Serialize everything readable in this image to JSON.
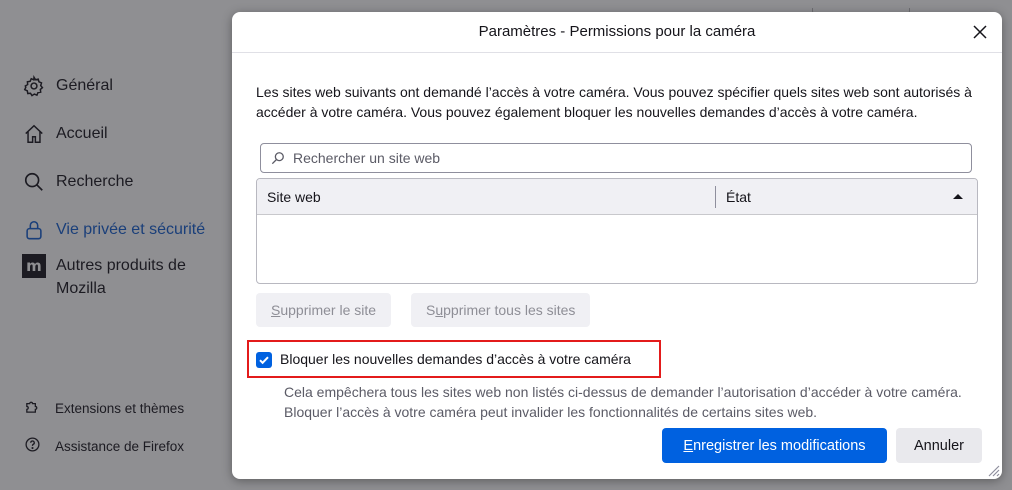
{
  "sidebar": {
    "items": [
      {
        "label": "Général",
        "icon": "gear-icon"
      },
      {
        "label": "Accueil",
        "icon": "home-icon"
      },
      {
        "label": "Recherche",
        "icon": "search-icon"
      },
      {
        "label": "Vie privée et sécurité",
        "icon": "lock-icon"
      },
      {
        "label": "Autres produits de Mozilla",
        "icon": "mozilla-icon"
      }
    ],
    "footer": [
      {
        "label": "Extensions et thèmes",
        "icon": "puzzle-icon"
      },
      {
        "label": "Assistance de Firefox",
        "icon": "help-icon"
      }
    ]
  },
  "dialog": {
    "title": "Paramètres - Permissions pour la caméra",
    "description": "Les sites web suivants ont demandé l’accès à votre caméra. Vous pouvez spécifier quels sites web sont autorisés à accéder à votre caméra. Vous pouvez également bloquer les nouvelles demandes d’accès à votre caméra.",
    "search_placeholder": "Rechercher un site web",
    "table": {
      "columns": [
        "Site web",
        "État"
      ],
      "rows": []
    },
    "remove_site": {
      "accel": "S",
      "rest": "upprimer le site"
    },
    "remove_all": {
      "pre": "S",
      "accel": "u",
      "rest": "pprimer tous les sites"
    },
    "block_checkbox": {
      "label": "Bloquer les nouvelles demandes d’accès à votre caméra",
      "checked": true,
      "description": "Cela empêchera tous les sites web non listés ci-dessus de demander l’autorisation d’accéder à votre caméra. Bloquer l’accès à votre caméra peut invalider les fonctionnalités de certains sites web."
    },
    "save": {
      "accel": "E",
      "rest": "nregistrer les modifications"
    },
    "cancel_label": "Annuler"
  },
  "colors": {
    "accent": "#0061e0",
    "highlight": "#e31b1b",
    "overlay": "#8f8f92",
    "active_nav": "#1a3f7a"
  }
}
